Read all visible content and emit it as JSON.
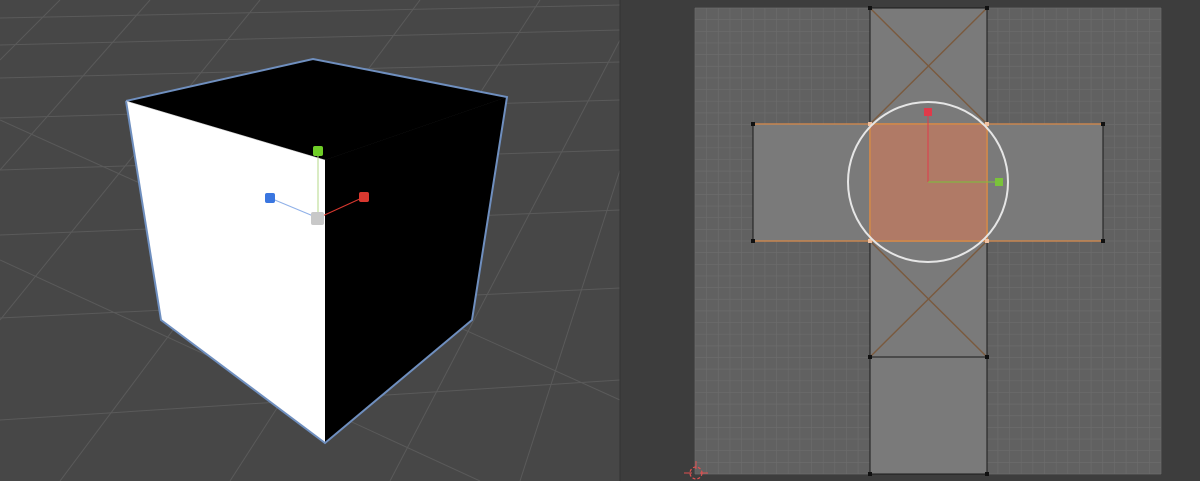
{
  "window": {
    "panels": [
      {
        "name": "3d-viewport",
        "kind": "scene view"
      },
      {
        "name": "uv-editor",
        "kind": "uv layout view"
      }
    ]
  },
  "viewport": {
    "background": "#474747",
    "grid_color": "#5a5a5a",
    "object": "cube",
    "selected_face": "front",
    "selection_outline_color": "#6f8fbf",
    "face_colors": {
      "front": "#ffffff",
      "top": "#000000",
      "right": "#000000"
    },
    "gizmo": {
      "icons": [
        "y-axis-handle-icon",
        "x-axis-handle-icon",
        "z-axis-handle-icon",
        "origin-handle-icon"
      ],
      "colors": {
        "x": "#d9382f",
        "y": "#6fce27",
        "z": "#3a76e0",
        "origin": "#c8c8c8"
      }
    }
  },
  "uv_editor": {
    "background": "#3d3d3d",
    "image_area_color": "#616161",
    "grid_color": "#6c6c6c",
    "island_color": "#7a7a7a",
    "selected_face_color": "#b07a66",
    "edge_highlight_color": "#c88650",
    "layout": "cross unwrap",
    "selected_faces": 1,
    "gizmo": {
      "icons": [
        "uv-rotate-circle-icon",
        "uv-y-handle-icon",
        "uv-x-handle-icon",
        "cursor-2d-icon"
      ],
      "colors": {
        "x": "#7ac33a",
        "y": "#e03a4a",
        "circle": "#e6e6e6",
        "cursor": "#e05050"
      }
    }
  }
}
